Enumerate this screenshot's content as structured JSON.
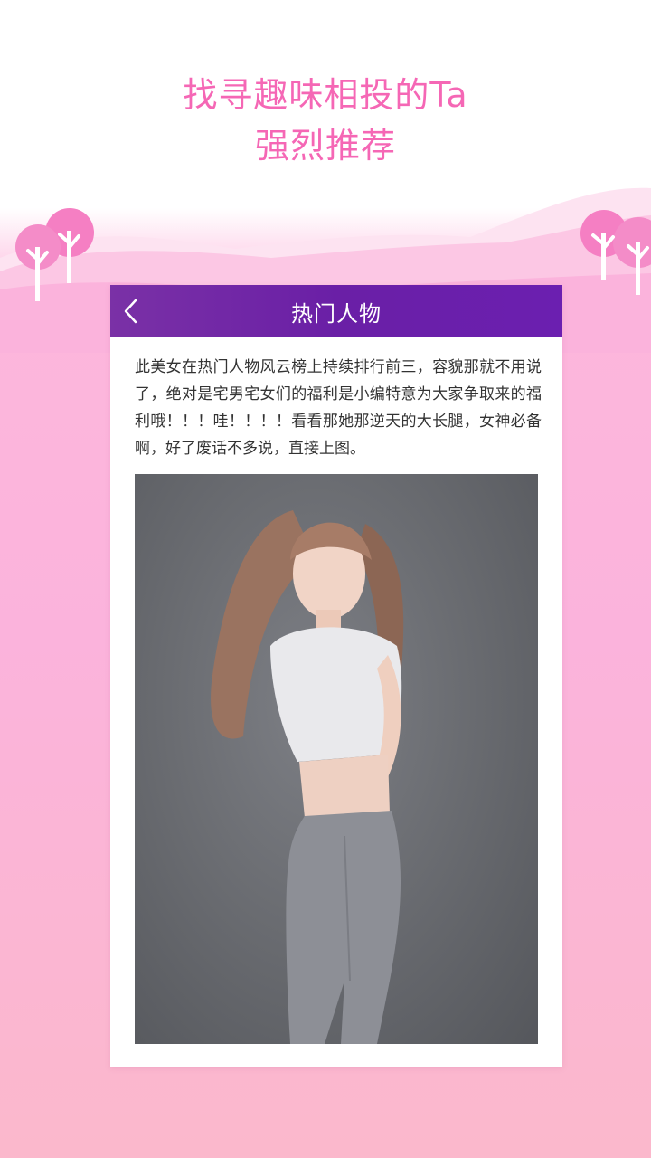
{
  "promo": {
    "line1": "找寻趣味相投的Ta",
    "line2": "强烈推荐"
  },
  "screen": {
    "title": "热门人物",
    "back_icon": "chevron-left-icon",
    "article": "此美女在热门人物风云榜上持续排行前三，容貌那就不用说了，绝对是宅男宅女们的福利是小编特意为大家争取来的福利哦！！！哇！！！！看看那她那逆天的大长腿，女神必备啊，好了废话不多说，直接上图。",
    "photo": "portrait-photo"
  },
  "colors": {
    "accent_pink": "#f567b5",
    "title_bar_purple": "#6a1fa6",
    "background_pink": "#fbb3dc"
  }
}
